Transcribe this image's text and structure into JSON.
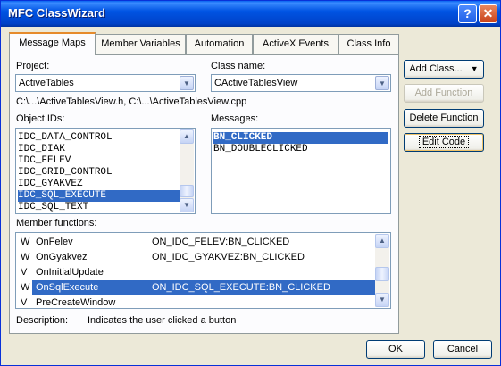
{
  "window": {
    "title": "MFC ClassWizard",
    "help": "?",
    "close": "✕"
  },
  "tabs": [
    {
      "label": "Message Maps",
      "active": true
    },
    {
      "label": "Member Variables"
    },
    {
      "label": "Automation"
    },
    {
      "label": "ActiveX Events"
    },
    {
      "label": "Class Info"
    }
  ],
  "project": {
    "label": "Project:",
    "value": "ActiveTables"
  },
  "class_name": {
    "label": "Class name:",
    "value": "CActiveTablesView"
  },
  "file_path": "C:\\...\\ActiveTablesView.h, C:\\...\\ActiveTablesView.cpp",
  "object_ids": {
    "label": "Object IDs:",
    "items": [
      "IDC_DATA_CONTROL",
      "IDC_DIAK",
      "IDC_FELEV",
      "IDC_GRID_CONTROL",
      "IDC_GYAKVEZ",
      "IDC_SQL_EXECUTE",
      "IDC_SQL_TEXT"
    ],
    "selected": "IDC_SQL_EXECUTE"
  },
  "messages": {
    "label": "Messages:",
    "items": [
      "BN_CLICKED",
      "BN_DOUBLECLICKED"
    ],
    "selected": "BN_CLICKED"
  },
  "member_functions": {
    "label": "Member functions:",
    "rows": [
      {
        "type": "W",
        "name": "OnFelev",
        "map": "ON_IDC_FELEV:BN_CLICKED"
      },
      {
        "type": "W",
        "name": "OnGyakvez",
        "map": "ON_IDC_GYAKVEZ:BN_CLICKED"
      },
      {
        "type": "V",
        "name": "OnInitialUpdate",
        "map": ""
      },
      {
        "type": "W",
        "name": "OnSqlExecute",
        "map": "ON_IDC_SQL_EXECUTE:BN_CLICKED",
        "selected": true
      },
      {
        "type": "V",
        "name": "PreCreateWindow",
        "map": ""
      }
    ]
  },
  "description": {
    "label": "Description:",
    "text": "Indicates the user clicked a button"
  },
  "buttons": {
    "add_class": "Add Class...",
    "add_function": "Add Function",
    "delete_function": "Delete Function",
    "edit_code": "Edit Code",
    "ok": "OK",
    "cancel": "Cancel"
  }
}
